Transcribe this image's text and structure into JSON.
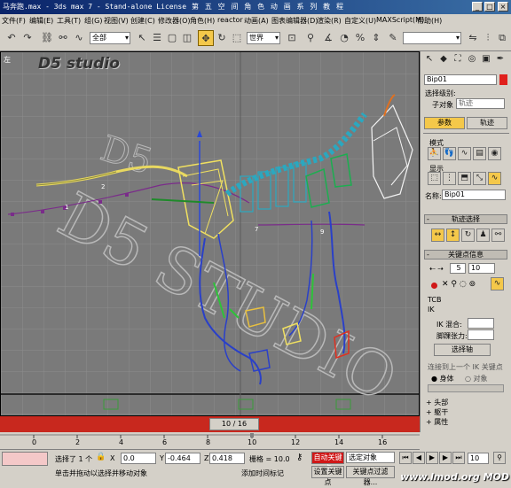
{
  "title": {
    "app_icon_label": "马奔跑.max - 3ds max 7 - Stand-alone License",
    "banner": "第 五 空 间 角 色 动 画 系 列 教 程",
    "win_buttons": [
      "_",
      "□",
      "×"
    ]
  },
  "menu": [
    "文件(F)",
    "编辑(E)",
    "工具(T)",
    "组(G)",
    "视图(V)",
    "创建(C)",
    "修改器(O)",
    "角色(H)",
    "reactor",
    "动画(A)",
    "图表编辑器(D)",
    "渲染(R)",
    "自定义(U)",
    "MAXScript(M)",
    "帮助(H)"
  ],
  "toolbar": {
    "selection_filter": "全部",
    "ref_coord": "世界",
    "named_sel": ""
  },
  "viewport": {
    "label": "左",
    "brand": "D5 studio"
  },
  "panel": {
    "object_name": "Bip01",
    "sel_level_label": "选择级别:",
    "sub_obj_label": "子对象",
    "sub_obj_value": "轨迹",
    "tab_params": "参数",
    "tab_trajectory": "轨迹",
    "mode_title": "模式",
    "display_title": "显示",
    "name_label": "名称:",
    "name_value": "Bip01",
    "track_sel_rollout": "轨迹选择",
    "key_info_rollout": "关键点信息",
    "key_number": "5",
    "key_time": "10",
    "tcb_label": "TCB",
    "ik_label": "IK",
    "ik_blend_label": "IK 混合:",
    "ankle_label": "脚踝张力:",
    "select_pivot_btn": "选择轴",
    "join_prev_label": "连接到上一个 IK 关键点",
    "body_label": "身体",
    "object_label": "对象",
    "footer_items": [
      "头部",
      "躯干",
      "属性"
    ]
  },
  "timeline": {
    "slider": "10 / 16",
    "ticks": [
      "0",
      "2",
      "4",
      "6",
      "8",
      "10",
      "12",
      "14",
      "16"
    ]
  },
  "status": {
    "selected": "选择了 1 个",
    "x": "0.0",
    "y": "-0.464",
    "z": "0.418",
    "grid": "栅格 = 10.0",
    "auto_key": "自动关键点",
    "sel_obj": "选定对象",
    "prompt": "单击并拖动以选择并移动对象",
    "add_time_tag": "添加时间标记",
    "set_key": "设置关键点",
    "key_filters": "关键点过滤器...",
    "frame": "10"
  },
  "watermark": "www.lmod.org  MOD",
  "colors": {
    "titlebar": "#0a246a",
    "timeslider": "#c8281e",
    "viewport": "#7a7a7a",
    "active": "#f4c84a"
  }
}
